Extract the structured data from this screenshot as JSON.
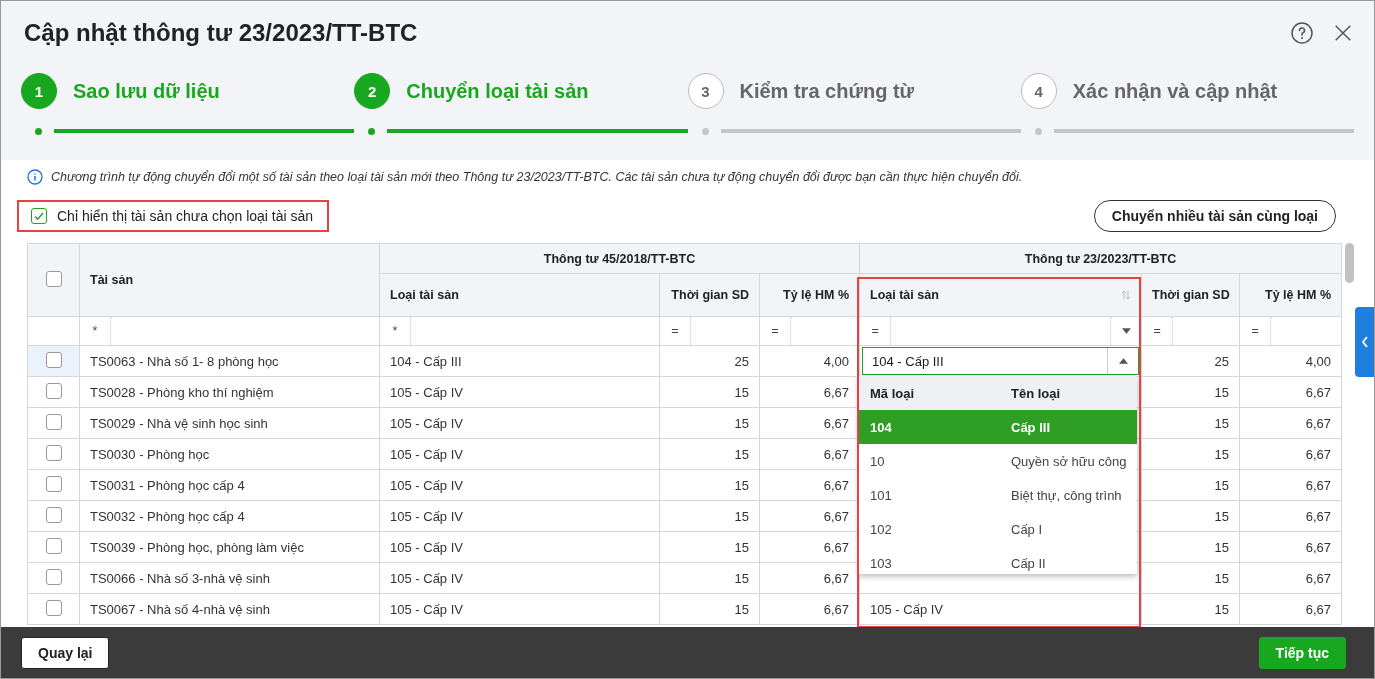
{
  "window": {
    "title": "Cập nhật thông tư 23/2023/TT-BTC"
  },
  "steps": [
    {
      "number": "1",
      "label": "Sao lưu dữ liệu",
      "done": true
    },
    {
      "number": "2",
      "label": "Chuyển loại tài sản",
      "done": true
    },
    {
      "number": "3",
      "label": "Kiểm tra chứng từ",
      "done": false
    },
    {
      "number": "4",
      "label": "Xác nhận và cập nhật",
      "done": false
    }
  ],
  "info": "Chương trình tự động chuyển đổi một số tài sản theo loại tài sản mới theo Thông tư 23/2023/TT-BTC. Các tài sản chưa tự động chuyển đổi được bạn cần thực hiện chuyển đổi.",
  "filter_checkbox": {
    "label": "Chỉ hiển thị tài sản chưa chọn loại tài sản",
    "checked": true
  },
  "bulk_button": "Chuyển nhiều tài sản cùng loại",
  "table": {
    "select_all_checked": false,
    "groups": [
      "Thông tư 45/2018/TT-BTC",
      "Thông tư 23/2023/TT-BTC"
    ],
    "columns": [
      "Tài sản",
      "Loại tài sản",
      "Thời gian SD",
      "Tỷ lệ HM %",
      "Loại tài sản",
      "Thời gian SD",
      "Tỷ lệ HM %"
    ],
    "filters": [
      "*",
      "*",
      "=",
      "=",
      "=",
      "=",
      "="
    ],
    "rows": [
      {
        "checked": false,
        "asset": "TS0063 - Nhà số 1- 8 phòng học",
        "old_type": "104 - Cấp III",
        "old_years": "25",
        "old_rate": "4,00",
        "new_years": "25",
        "new_rate": "4,00"
      },
      {
        "checked": false,
        "asset": "TS0028 - Phòng kho thí nghiệm",
        "old_type": "105 - Cấp IV",
        "old_years": "15",
        "old_rate": "6,67",
        "new_years": "15",
        "new_rate": "6,67"
      },
      {
        "checked": false,
        "asset": "TS0029 - Nhà vệ sinh học sinh",
        "old_type": "105 - Cấp IV",
        "old_years": "15",
        "old_rate": "6,67",
        "new_years": "15",
        "new_rate": "6,67"
      },
      {
        "checked": false,
        "asset": "TS0030 - Phòng học",
        "old_type": "105 - Cấp IV",
        "old_years": "15",
        "old_rate": "6,67",
        "new_years": "15",
        "new_rate": "6,67"
      },
      {
        "checked": false,
        "asset": "TS0031 - Phòng học cấp 4",
        "old_type": "105 - Cấp IV",
        "old_years": "15",
        "old_rate": "6,67",
        "new_years": "15",
        "new_rate": "6,67"
      },
      {
        "checked": false,
        "asset": "TS0032 - Phòng học cấp 4",
        "old_type": "105 - Cấp IV",
        "old_years": "15",
        "old_rate": "6,67",
        "new_years": "15",
        "new_rate": "6,67"
      },
      {
        "checked": false,
        "asset": "TS0039 - Phòng học, phòng làm việc",
        "old_type": "105 - Cấp IV",
        "old_years": "15",
        "old_rate": "6,67",
        "new_years": "15",
        "new_rate": "6,67"
      },
      {
        "checked": false,
        "asset": "TS0066 - Nhà số 3-nhà vệ sinh",
        "old_type": "105 - Cấp IV",
        "old_years": "15",
        "old_rate": "6,67",
        "new_years": "15",
        "new_rate": "6,67"
      },
      {
        "checked": false,
        "asset": "TS0067 - Nhà số 4-nhà vệ sinh",
        "old_type": "105 - Cấp IV",
        "old_years": "15",
        "old_rate": "6,67",
        "new_type": "105 - Cấp IV",
        "new_years": "15",
        "new_rate": "6,67"
      }
    ]
  },
  "editor": {
    "value": "104 - Cấp III",
    "headers": [
      "Mã loại",
      "Tên loại"
    ],
    "options": [
      {
        "code": "104",
        "name": "Cấp III",
        "selected": true
      },
      {
        "code": "10",
        "name": "Quyền sở hữu công",
        "selected": false
      },
      {
        "code": "101",
        "name": "Biệt thự, công trình",
        "selected": false
      },
      {
        "code": "102",
        "name": "Cấp I",
        "selected": false
      },
      {
        "code": "103",
        "name": "Cấp II",
        "selected": false
      }
    ]
  },
  "footer": {
    "back": "Quay lại",
    "next": "Tiếp tục"
  }
}
